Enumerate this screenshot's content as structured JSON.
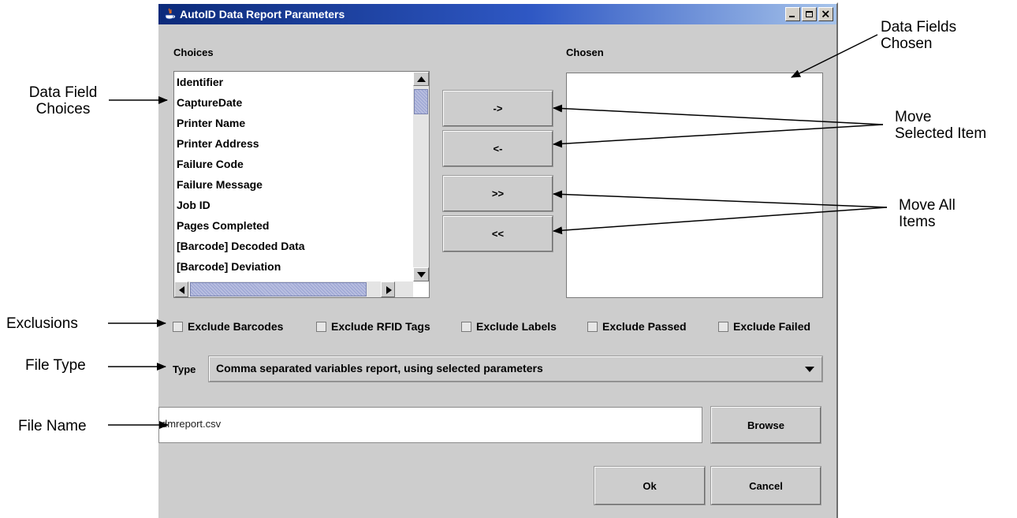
{
  "window": {
    "title": "AutoID Data Report Parameters",
    "controls": [
      "minimize-icon",
      "maximize-icon",
      "close-icon"
    ]
  },
  "choices": {
    "label": "Choices",
    "items": [
      "Identifier",
      "CaptureDate",
      "Printer Name",
      "Printer Address",
      "Failure Code",
      "Failure Message",
      "Job ID",
      "Pages Completed",
      "[Barcode] Decoded Data",
      "[Barcode] Deviation"
    ]
  },
  "chosen": {
    "label": "Chosen",
    "items": []
  },
  "move_buttons": {
    "add": "->",
    "remove": "<-",
    "add_all": ">>",
    "remove_all": "<<"
  },
  "exclusions": [
    {
      "label": "Exclude Barcodes",
      "checked": false
    },
    {
      "label": "Exclude RFID Tags",
      "checked": false
    },
    {
      "label": "Exclude Labels",
      "checked": false
    },
    {
      "label": "Exclude Passed",
      "checked": false
    },
    {
      "label": "Exclude Failed",
      "checked": false
    }
  ],
  "type": {
    "label": "Type",
    "selected": "Comma separated variables report, using selected parameters"
  },
  "file": {
    "value": "dmreport.csv",
    "browse_label": "Browse"
  },
  "footer": {
    "ok_label": "Ok",
    "cancel_label": "Cancel"
  },
  "annotations": {
    "data_field_choices": [
      "Data Field",
      "Choices"
    ],
    "data_fields_chosen": [
      "Data Fields",
      "Chosen"
    ],
    "move_selected_item": [
      "Move",
      "Selected Item"
    ],
    "move_all_items": [
      "Move All",
      "Items"
    ],
    "exclusions": "Exclusions",
    "file_type": "File Type",
    "file_name": "File Name"
  }
}
